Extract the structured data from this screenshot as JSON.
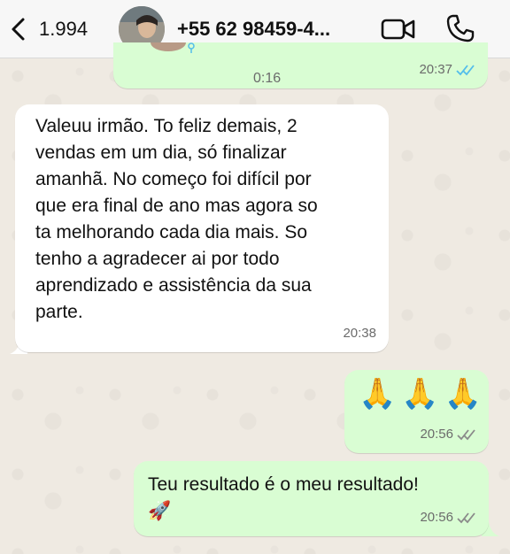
{
  "header": {
    "back_count": "1.994",
    "contact_name": "+55 62 98459-4...",
    "icons": [
      "chevron-left-icon",
      "video-call-icon",
      "phone-call-icon"
    ]
  },
  "messages": [
    {
      "type": "audio",
      "direction": "outgoing",
      "duration": "0:16",
      "time": "20:37",
      "status": "read"
    },
    {
      "type": "text",
      "direction": "incoming",
      "lines": [
        "Valeuu irmão. To feliz demais, 2",
        "vendas em um dia, só finalizar",
        "amanhã. No começo foi difícil por",
        "que era final de ano mas agora so",
        "ta melhorando cada dia mais. So",
        "tenho a agradecer ai por todo",
        "aprendizado e assistência da sua",
        "parte."
      ],
      "time": "20:38"
    },
    {
      "type": "emoji",
      "direction": "outgoing",
      "text": "🙏🙏🙏",
      "time": "20:56",
      "status": "delivered"
    },
    {
      "type": "text",
      "direction": "outgoing",
      "text": "Teu resultado é o meu resultado!",
      "emoji": "🚀",
      "time": "20:56",
      "status": "delivered"
    }
  ],
  "colors": {
    "outgoing_bubble": "#d9fdd3",
    "incoming_bubble": "#ffffff",
    "read_ticks": "#53bdeb",
    "delivered_ticks": "#8a8a8a"
  }
}
